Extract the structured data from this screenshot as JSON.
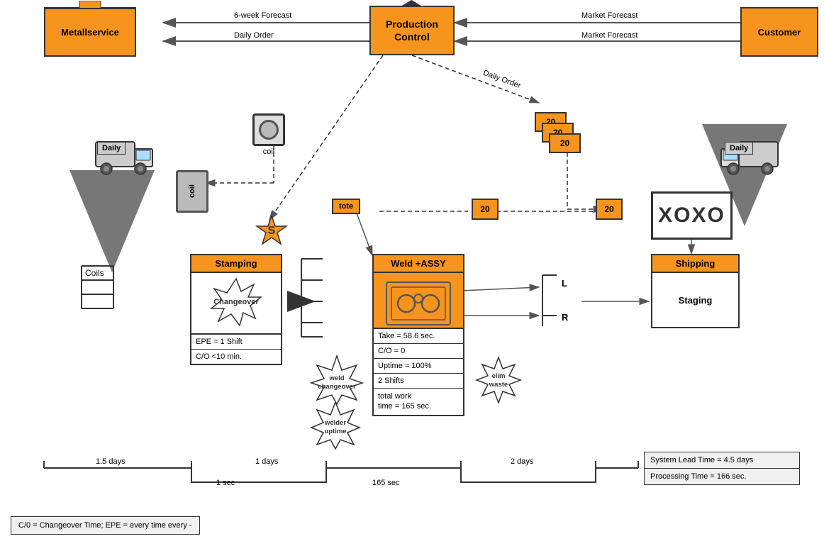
{
  "header": {
    "production_control": "Production\nControl",
    "metallservice": "Metallservice",
    "customer": "Customer"
  },
  "arrows": {
    "six_week_forecast": "6-week Forecast",
    "daily_order_left": "Daily Order",
    "market_forecast_top": "Market Forecast",
    "market_forecast_bottom": "Market Forecast",
    "daily_order_right": "Daily Order",
    "daily_left": "Daily",
    "daily_right": "Daily"
  },
  "process": {
    "stamping": {
      "name": "Stamping",
      "body": "Changeover",
      "epe": "EPE = 1 Shift",
      "co": "C/O <10 min."
    },
    "weld_assy": {
      "name": "Weld +ASSY",
      "take": "Take = 58.6 sec.",
      "co": "C/O = 0",
      "uptime": "Uptime = 100%",
      "shifts": "2 Shifts",
      "total_work": "total work\ntime = 165 sec."
    },
    "shipping": {
      "name": "Shipping",
      "staging": "Staging"
    }
  },
  "kaizen": {
    "weld_changeover": "weld\nchangeover",
    "welder_uptime": "welder\nuptime",
    "elim_waste": "elim\nwaste"
  },
  "inventory": {
    "coil_top": "coil",
    "coil_label": "coil",
    "tote": "tote",
    "inv_20_1": "20",
    "inv_20_2": "20",
    "inv_20_3": "20",
    "inv_20_mid": "20",
    "inv_20_right": "20",
    "coils_label": "Coils"
  },
  "timeline": {
    "days_1": "1.5 days",
    "days_2": "1 days",
    "days_3": "2 days",
    "sec_1": "1 sec",
    "sec_2": "165 sec",
    "system_lead": "System Lead Time = 4.5 days",
    "processing_time": "Processing Time = 166 sec."
  },
  "legend": {
    "text": "C/0 = Changeover Time; EPE = every time every -"
  }
}
